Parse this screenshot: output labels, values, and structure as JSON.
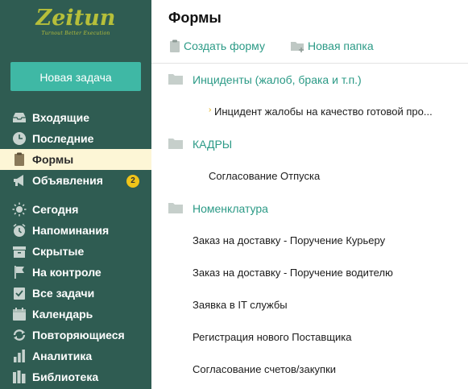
{
  "brand": {
    "name": "Zeitun",
    "tagline": "Turnout Better Execution"
  },
  "sidebar": {
    "new_task_label": "Новая задача",
    "items": [
      {
        "label": "Входящие",
        "icon": "inbox-icon"
      },
      {
        "label": "Последние",
        "icon": "clock-icon"
      },
      {
        "label": "Формы",
        "icon": "clipboard-icon",
        "active": true
      },
      {
        "label": "Объявления",
        "icon": "megaphone-icon",
        "badge": "2"
      },
      {
        "label": "Сегодня",
        "icon": "sun-icon"
      },
      {
        "label": "Напоминания",
        "icon": "alarm-icon"
      },
      {
        "label": "Скрытые",
        "icon": "archive-box-icon"
      },
      {
        "label": "На контроле",
        "icon": "flag-icon"
      },
      {
        "label": "Все задачи",
        "icon": "tasks-icon"
      },
      {
        "label": "Календарь",
        "icon": "calendar-icon"
      },
      {
        "label": "Повторяющиеся",
        "icon": "repeat-icon"
      },
      {
        "label": "Аналитика",
        "icon": "bar-chart-icon"
      },
      {
        "label": "Библиотека",
        "icon": "library-icon"
      }
    ]
  },
  "main": {
    "title": "Формы",
    "toolbar": {
      "create_form": "Создать форму",
      "new_folder": "Новая папка"
    },
    "folders": [
      {
        "name": "Инциденты (жалоб, брака и т.п.)",
        "forms": [
          {
            "name": "Инцидент жалобы на качество готовой про...",
            "sub": true
          }
        ]
      },
      {
        "name": "КАДРЫ",
        "forms": [
          {
            "name": "Согласование Отпуска"
          }
        ]
      },
      {
        "name": "Номенклатура",
        "forms": [
          {
            "name": "Заказ на доставку - Поручение Курьеру"
          },
          {
            "name": "Заказ на доставку - Поручение водителю"
          },
          {
            "name": "Заявка в IT службы"
          },
          {
            "name": "Регистрация нового Поставщика"
          },
          {
            "name": "Согласование счетов/закупки"
          }
        ]
      }
    ]
  },
  "colors": {
    "sidebar_bg": "#2f5c52",
    "accent": "#3fb8a5",
    "link": "#2b9a86",
    "active_bg": "#fdf6d6",
    "badge": "#f0c419",
    "logo": "#b6bf3a"
  }
}
